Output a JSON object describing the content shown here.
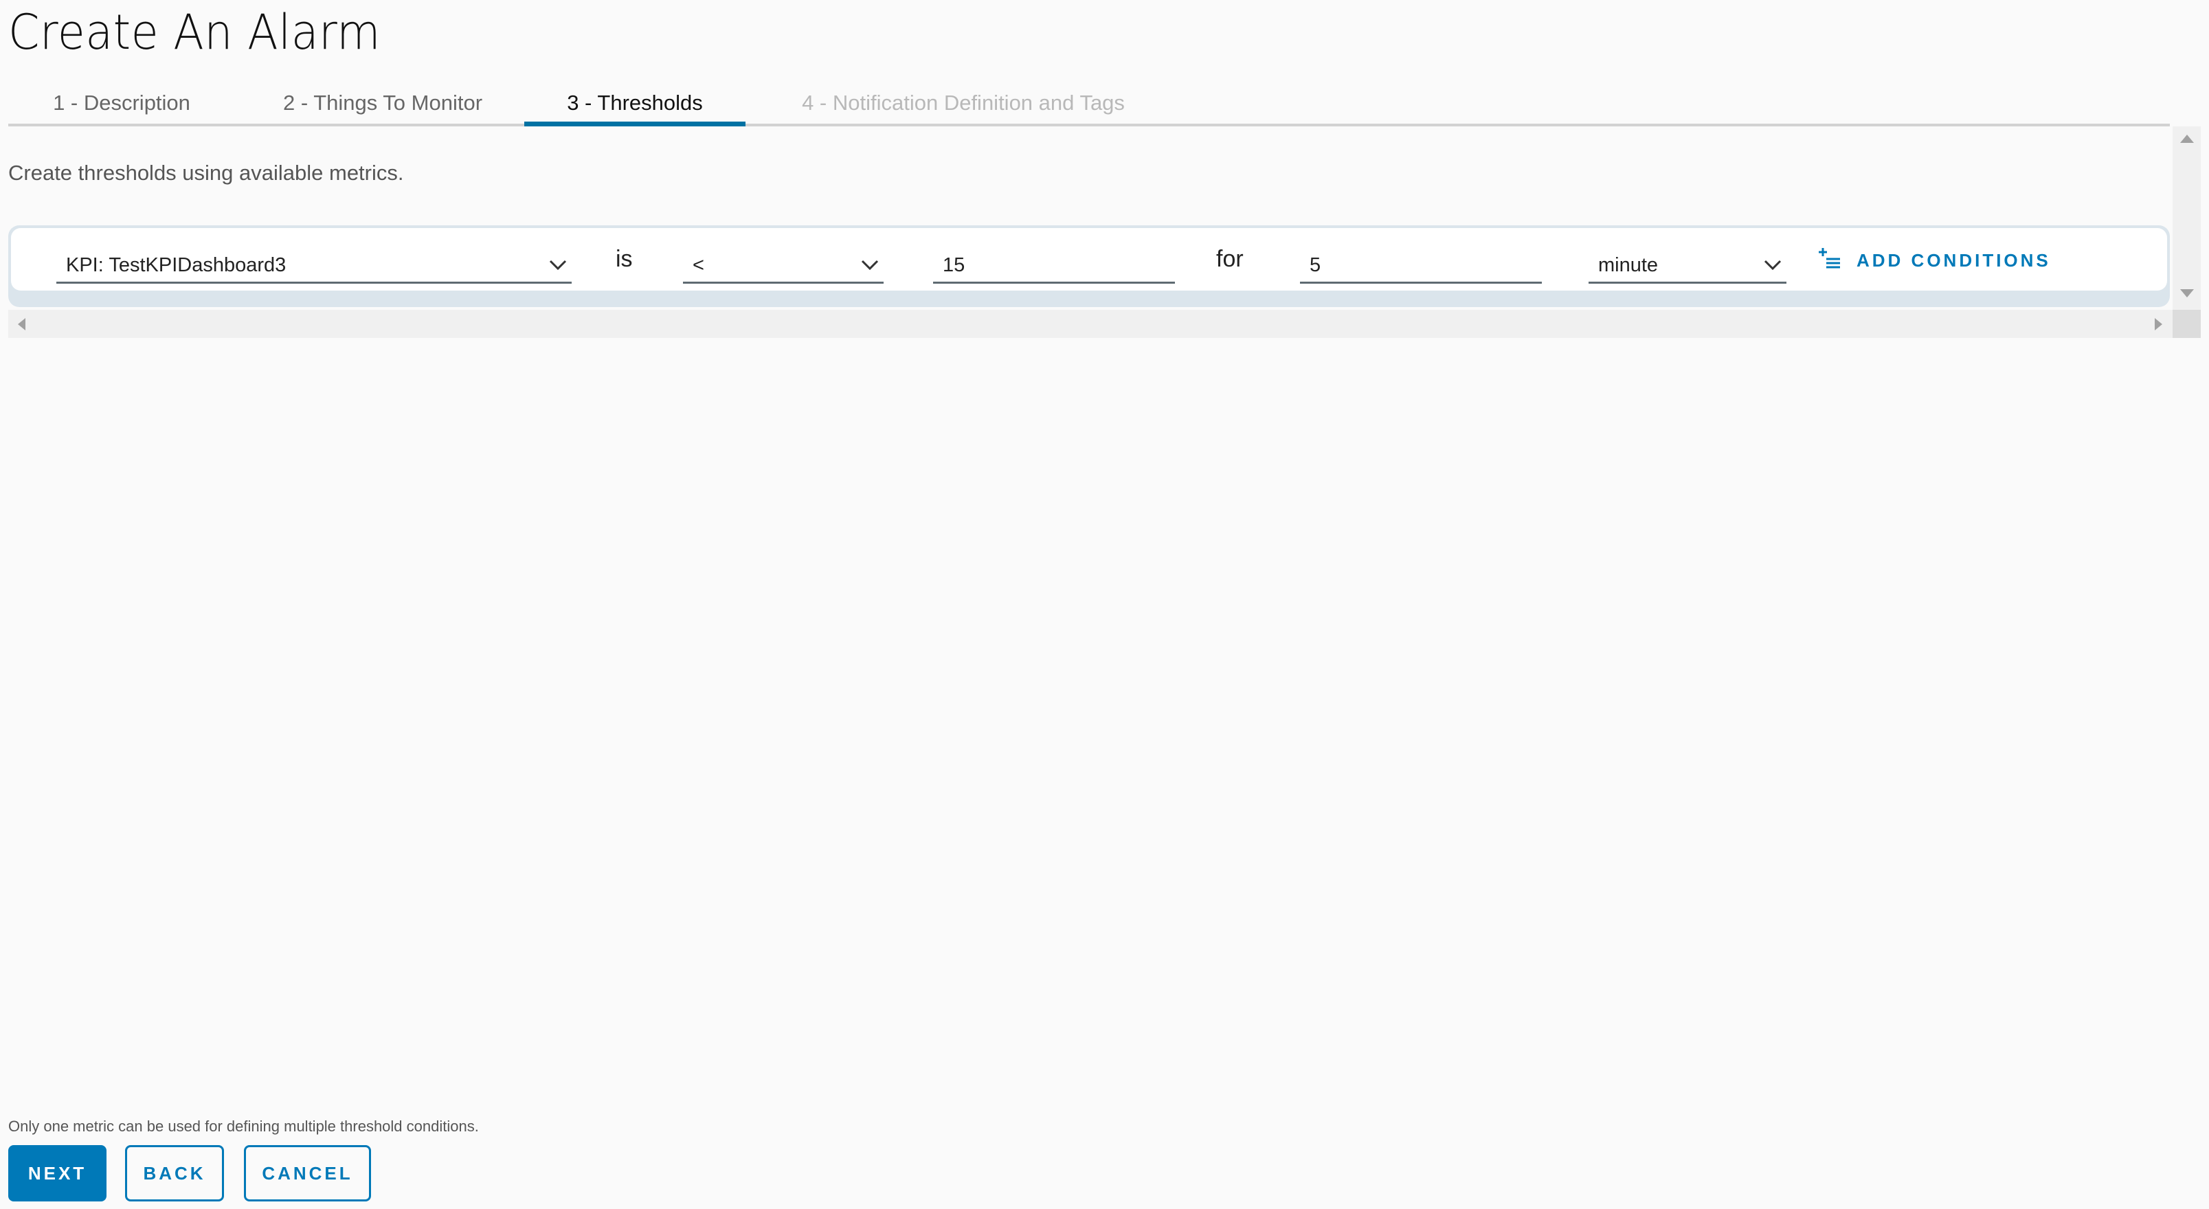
{
  "page": {
    "title": "Create An Alarm"
  },
  "tabs": [
    {
      "label": "1 - Description",
      "state": "complete"
    },
    {
      "label": "2 - Things To Monitor",
      "state": "complete"
    },
    {
      "label": "3 - Thresholds",
      "state": "active"
    },
    {
      "label": "4 - Notification Definition and Tags",
      "state": "disabled"
    }
  ],
  "thresholds": {
    "instruction": "Create thresholds using available metrics.",
    "condition": {
      "metric": {
        "value": "KPI: TestKPIDashboard3",
        "icon": "chevron-down-icon"
      },
      "is_label": "is",
      "operator": {
        "value": "<",
        "icon": "chevron-down-icon"
      },
      "threshold_value": "15",
      "for_label": "for",
      "duration_value": "5",
      "duration_unit": {
        "value": "minute",
        "icon": "chevron-down-icon"
      }
    },
    "add_conditions": {
      "label": "ADD CONDITIONS",
      "icon": "add-list-icon"
    }
  },
  "footer": {
    "note": "Only one metric can be used for defining multiple threshold conditions.",
    "buttons": {
      "next": "NEXT",
      "back": "BACK",
      "cancel": "CANCEL"
    }
  },
  "colors": {
    "accent": "#0079b8",
    "active_tab_underline": "#0072a3",
    "card_border": "#dbe5ec",
    "background": "#fafafa"
  }
}
